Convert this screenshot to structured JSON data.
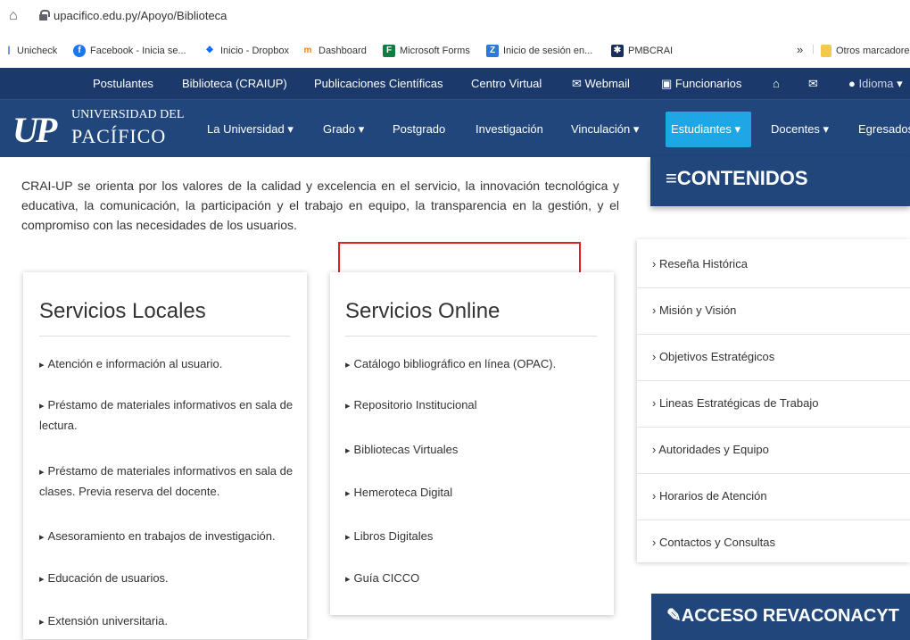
{
  "browser": {
    "url": "upacifico.edu.py/Apoyo/Biblioteca",
    "bookmarks": [
      {
        "label": "Unicheck"
      },
      {
        "label": "Facebook - Inicia se..."
      },
      {
        "label": "Inicio - Dropbox"
      },
      {
        "label": "Dashboard"
      },
      {
        "label": "Microsoft Forms"
      },
      {
        "label": "Inicio de sesión en..."
      },
      {
        "label": "PMBCRAI"
      },
      {
        "label": "»"
      },
      {
        "label": "Otros marcadore"
      }
    ]
  },
  "topnav": {
    "items": [
      "Postulantes",
      "Biblioteca (CRAIUP)",
      "Publicaciones Científicas",
      "Centro Virtual",
      "Webmail",
      "Funcionarios",
      "Idioma"
    ]
  },
  "mainnav": {
    "logo_top": "UNIVERSIDAD DEL",
    "logo_bottom": "PACÍFICO",
    "logo_mark": "UP",
    "items": [
      "La Universidad",
      "Grado",
      "Postgrado",
      "Investigación",
      "Vinculación",
      "Estudiantes",
      "Docentes",
      "Egresados"
    ]
  },
  "intro": {
    "text": "CRAI-UP se orienta por los valores de la calidad y excelencia en el servicio, la innovación tecnológica y educativa, la comunicación, la participación y el trabajo en equipo, la transparencia en la gestión, y el compromiso con las necesidades de los usuarios."
  },
  "locales": {
    "title": "Servicios Locales",
    "items": [
      "Atención e información al usuario.",
      "Préstamo de materiales informativos en sala de lectura.",
      "Préstamo de materiales informativos en sala de clases. Previa reserva del docente.",
      "Asesoramiento en trabajos de investigación.",
      "Educación de usuarios.",
      "Extensión universitaria."
    ]
  },
  "online": {
    "title": "Servicios Online",
    "items": [
      "Catálogo bibliográfico en línea (OPAC).",
      "Repositorio Institucional",
      "Bibliotecas Virtuales",
      "Hemeroteca Digital",
      "Libros Digitales",
      "Guía CICCO"
    ]
  },
  "sidebar": {
    "heading": "≡CONTENIDOS",
    "items": [
      "› Reseña Histórica",
      "› Misión y Visión",
      "› Objetivos Estratégicos",
      "› Lineas Estratégicas de Trabajo",
      "› Autoridades y Equipo",
      "› Horarios de Atención",
      "› Contactos y Consultas"
    ],
    "revaconacyt": "ACCESO REVACONACYT"
  }
}
